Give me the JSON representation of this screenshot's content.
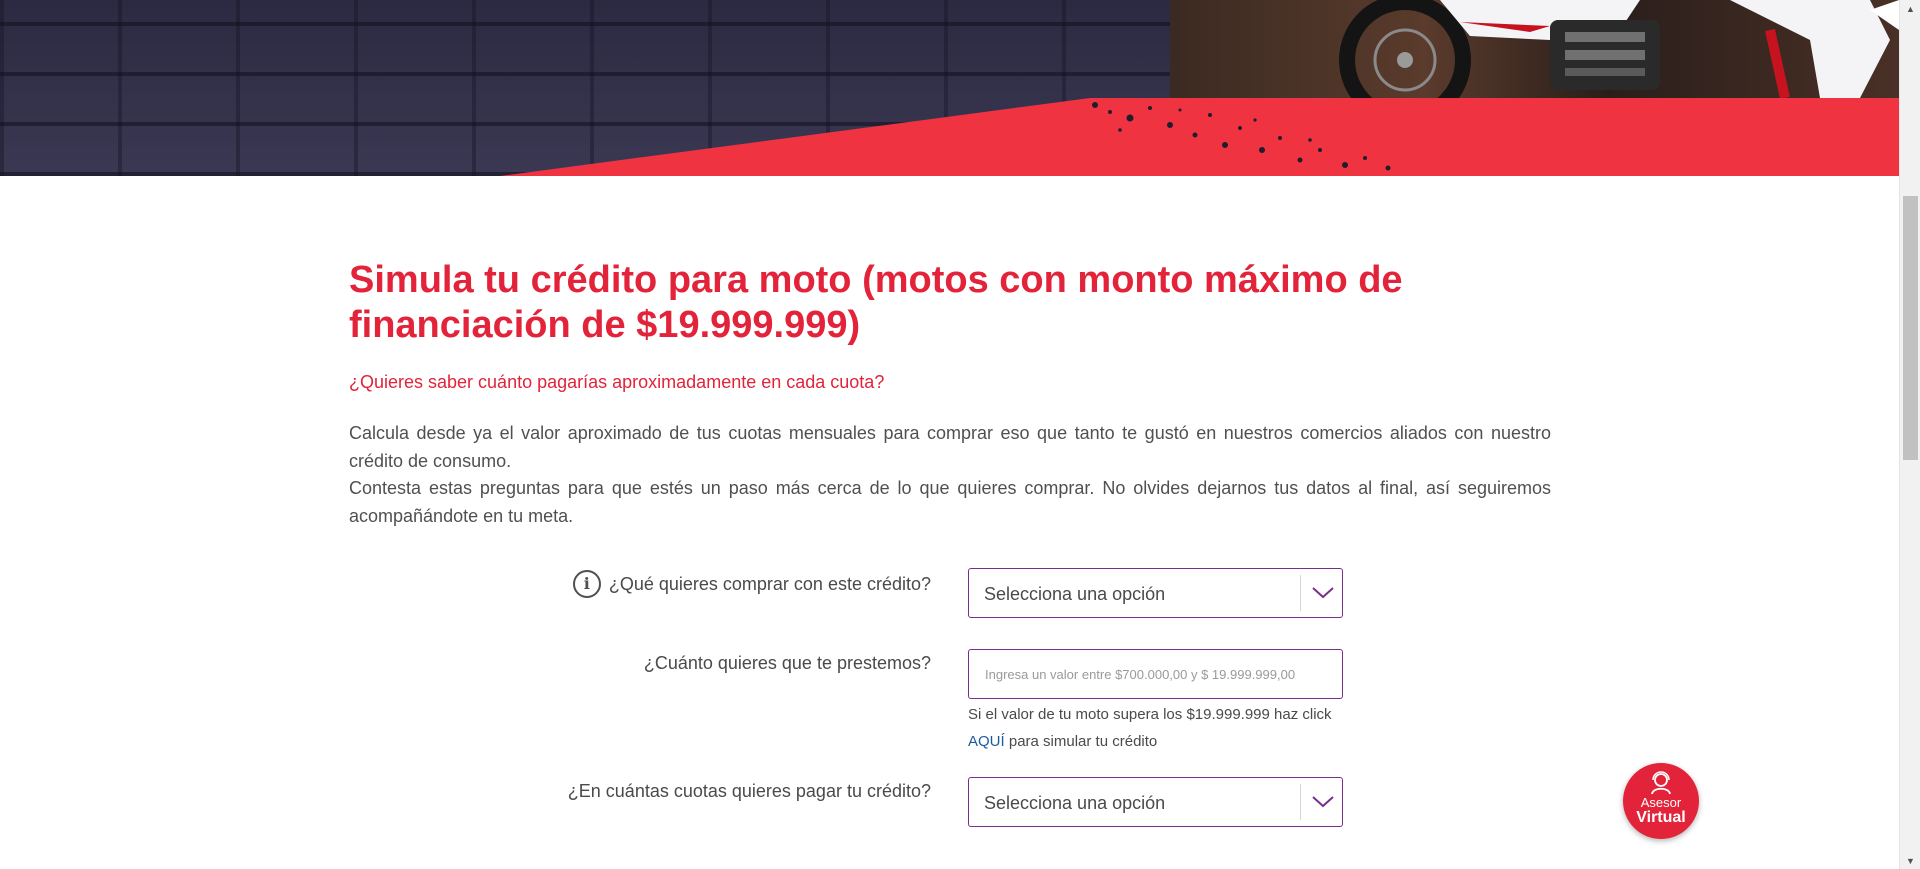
{
  "heading": {
    "title": "Simula tu crédito para moto (motos con monto máximo de financiación de $19.999.999)",
    "subtitle": "¿Quieres saber cuánto pagarías aproximadamente en cada cuota?",
    "paragraphs": [
      "Calcula desde ya el valor aproximado de tus cuotas mensuales para comprar eso que tanto te gustó en nuestros comercios aliados con nuestro crédito de consumo.",
      "Contesta estas preguntas para que estés un paso más cerca de lo que quieres comprar. No olvides dejarnos tus datos al final, así seguiremos acompañándote en tu meta."
    ]
  },
  "form": {
    "q1": {
      "label": "¿Qué quieres comprar con este crédito?",
      "selected": "Selecciona una opción",
      "icon": "info-icon"
    },
    "q2": {
      "label": "¿Cuánto quieres que te prestemos?",
      "placeholder": "Ingresa un valor entre $700.000,00 y $ 19.999.999,00",
      "help_text": "Si el valor de tu moto supera los $19.999.999 haz click",
      "help_link": "AQUÍ",
      "help_suffix": "para simular tu crédito"
    },
    "q3": {
      "label": "¿En cuántas cuotas quieres pagar tu crédito?",
      "selected": "Selecciona una opción"
    }
  },
  "asesor": {
    "line1": "Asesor",
    "line2": "Virtual",
    "icon": "headset-agent-icon"
  },
  "colors": {
    "brand_red": "#e2233a",
    "field_border": "#7b2d8b",
    "link_blue": "#1f5aa0",
    "hero_dark": "#32304a"
  }
}
